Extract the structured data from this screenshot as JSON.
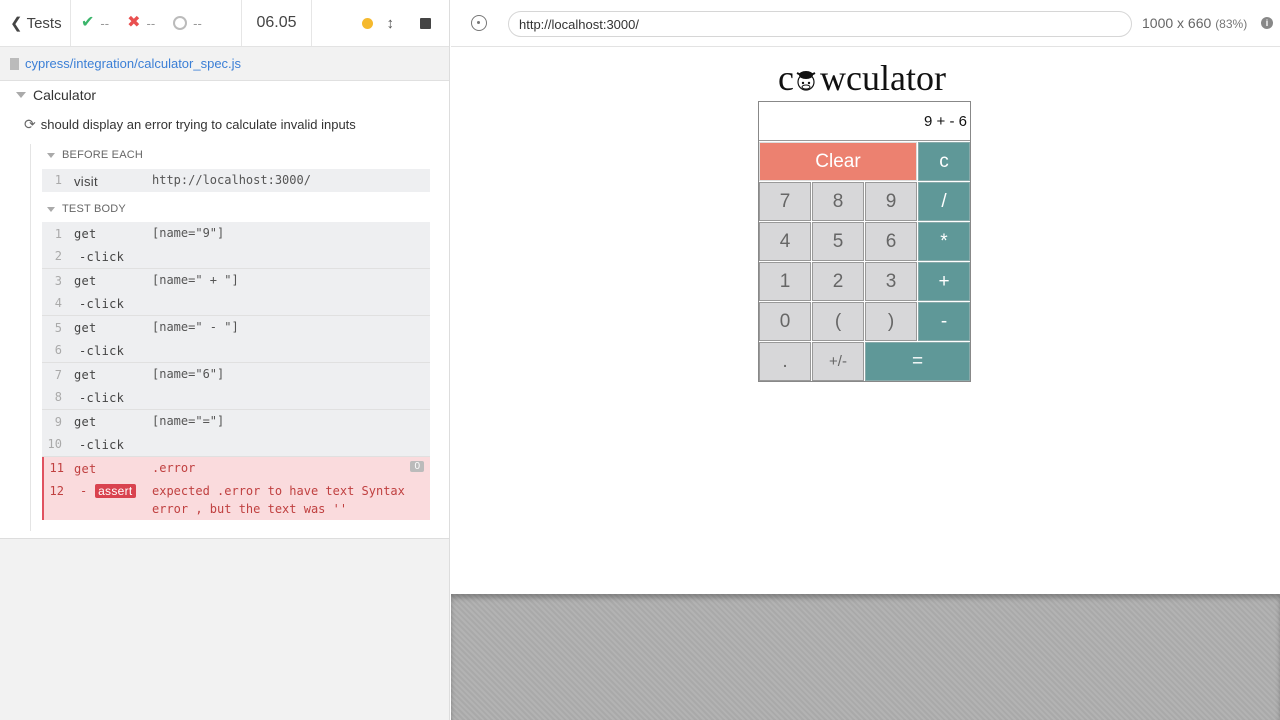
{
  "reporter": {
    "header": {
      "tests_label": "Tests",
      "passed": "--",
      "failed": "--",
      "pending": "--",
      "duration": "06.05"
    },
    "spec_path": "cypress/integration/calculator_spec.js",
    "suite_title": "Calculator",
    "test_title": "should display an error trying to calculate invalid inputs",
    "before_each": {
      "title": "BEFORE EACH",
      "commands": [
        {
          "num": "1",
          "name": "visit",
          "arg": "http://localhost:3000/"
        }
      ]
    },
    "test_body": {
      "title": "TEST BODY",
      "commands": [
        {
          "num": "1",
          "name": "get",
          "arg": "[name=\"9\"]",
          "child_num": "2",
          "child_name": "-click"
        },
        {
          "num": "3",
          "name": "get",
          "arg": "[name=\" + \"]",
          "child_num": "4",
          "child_name": "-click"
        },
        {
          "num": "5",
          "name": "get",
          "arg": "[name=\" - \"]",
          "child_num": "6",
          "child_name": "-click"
        },
        {
          "num": "7",
          "name": "get",
          "arg": "[name=\"6\"]",
          "child_num": "8",
          "child_name": "-click"
        },
        {
          "num": "9",
          "name": "get",
          "arg": "[name=\"=\"]",
          "child_num": "10",
          "child_name": "-click"
        }
      ],
      "error_command": {
        "num": "11",
        "name": "get",
        "arg": ".error",
        "count": "0",
        "child_num": "12",
        "child_prefix": "-",
        "child_name": "assert",
        "message": "expected .error to have text Syntax error , but the text was ''"
      }
    }
  },
  "aut": {
    "url": "http://localhost:3000/",
    "viewport": "1000 x 660",
    "scale": "(83%)",
    "info_icon": "i",
    "calculator": {
      "title_prefix": "c",
      "title_suffix": "wculator",
      "display": "9 +  - 6",
      "keys": {
        "clear": "Clear",
        "c": "c",
        "k7": "7",
        "k8": "8",
        "k9": "9",
        "div": "/",
        "k4": "4",
        "k5": "5",
        "k6": "6",
        "mul": "*",
        "k1": "1",
        "k2": "2",
        "k3": "3",
        "add": "+",
        "k0": "0",
        "lparen": "(",
        "rparen": ")",
        "sub": "-",
        "dot": ".",
        "neg": "+/-",
        "eq": "="
      }
    }
  },
  "colors": {
    "passed": "#3bb56b",
    "failed": "#e94f4f",
    "running": "#f5b92e",
    "link": "#3b7fd6",
    "error_bg": "#fadbdd",
    "operator_key": "#5f9898",
    "clear_key": "#ec8170"
  }
}
